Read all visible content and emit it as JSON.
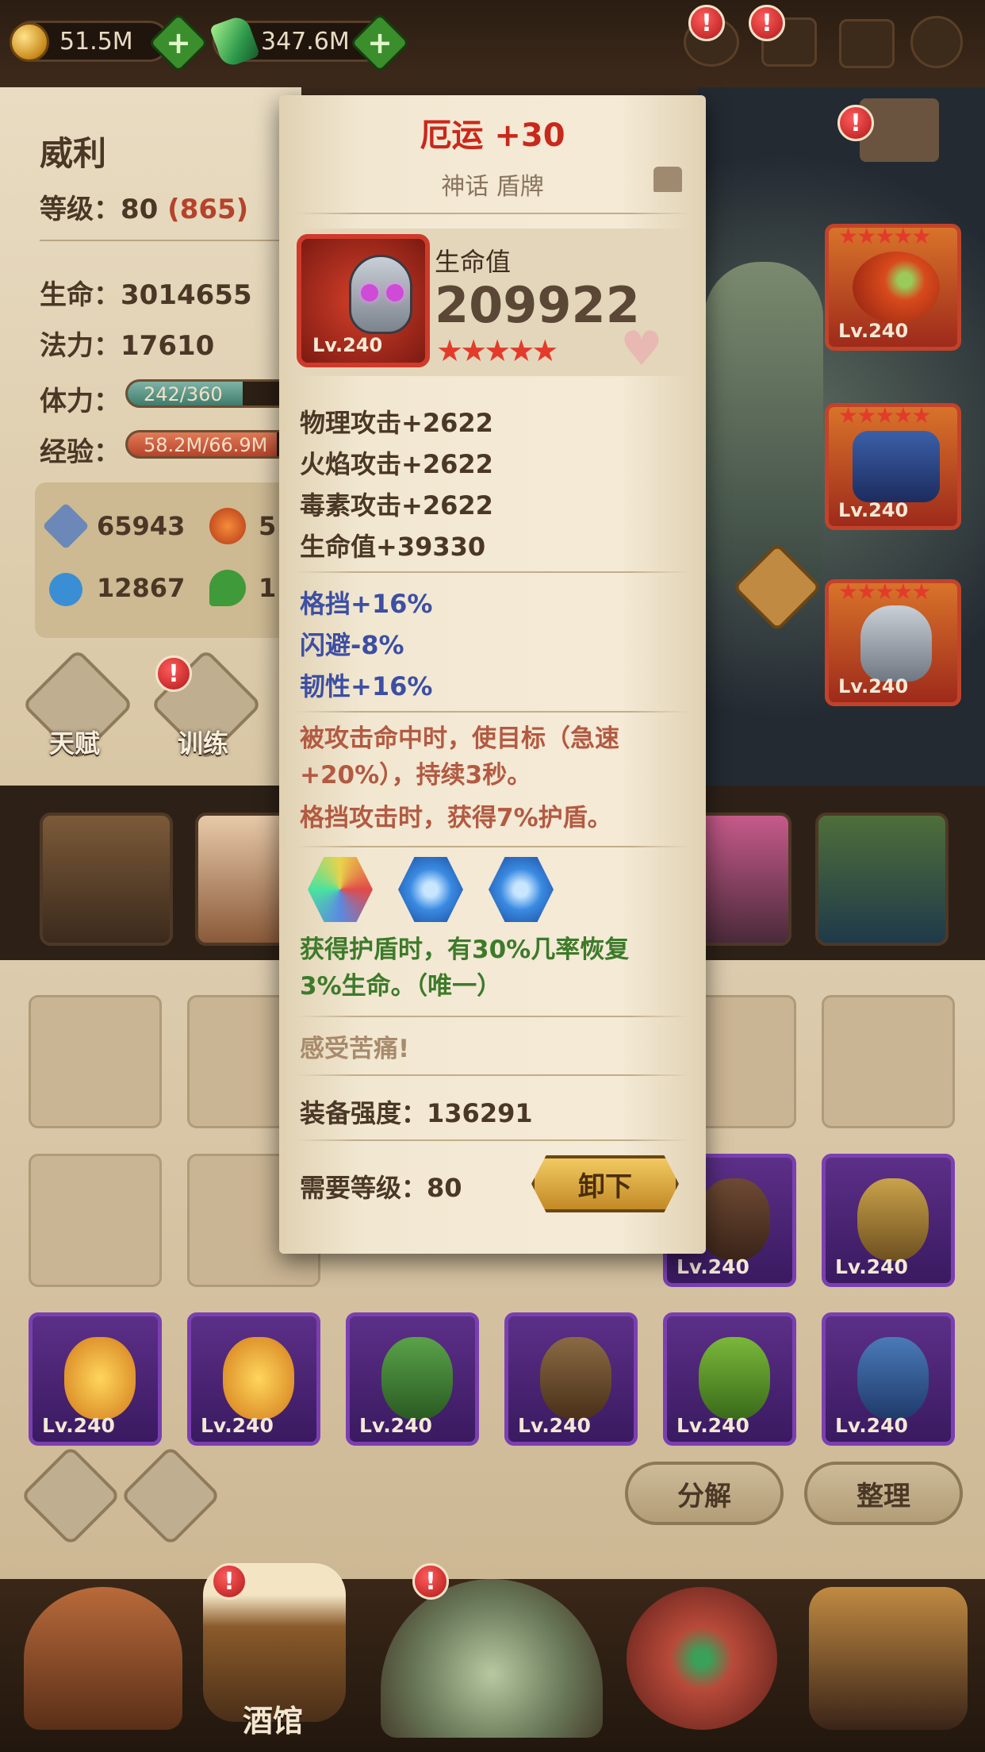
{
  "topbar": {
    "gold": "51.5M",
    "gems": "347.6M",
    "alert_mark": "!"
  },
  "hero": {
    "name": "威利",
    "level_label": "等级：",
    "level": "80",
    "level_extra": "(865)",
    "hp_label": "生命：",
    "hp": "3014655",
    "mp_label": "法力：",
    "mp": "17610",
    "stamina_label": "体力：",
    "stamina": "242/360",
    "stamina_fraction": 0.67,
    "exp_label": "经验：",
    "exp": "58.2M/66.9M",
    "exp_fraction": 0.87,
    "stats": [
      "65943",
      "5",
      "12867",
      "1"
    ],
    "tabs": [
      "天赋",
      "训练"
    ]
  },
  "equipment_slots": [
    {
      "label": "Lv.240",
      "stars": "★★★★★"
    },
    {
      "label": "Lv.240",
      "stars": "★★★★★"
    },
    {
      "label": "Lv.240",
      "stars": "★★★★★"
    }
  ],
  "tooltip": {
    "title": "厄运 +30",
    "subtitle": "神话 盾牌",
    "item_level": "Lv.240",
    "main_stat_label": "生命值",
    "main_stat_value": "209922",
    "stars": "★★★★★",
    "base_stats": [
      "物理攻击+2622",
      "火焰攻击+2622",
      "毒素攻击+2622",
      "生命值+39330"
    ],
    "bonus_stats": [
      "格挡+16%",
      "闪避-8%",
      "韧性+16%"
    ],
    "effect_lines": [
      "被攻击命中时，使目标（急速",
      "+20%），持续3秒。",
      "格挡攻击时，获得7%护盾。"
    ],
    "set_lines": [
      "获得护盾时，有30%几率恢复",
      "3%生命。（唯一）"
    ],
    "flavor": "感受苦痛!",
    "power_label": "装备强度：",
    "power": "136291",
    "req_label": "需要等级：",
    "req_level": "80",
    "unequip": "卸下"
  },
  "inventory": {
    "item_label": "Lv.240",
    "actions": [
      "分解",
      "整理"
    ]
  },
  "nav": {
    "tavern": "酒馆"
  },
  "colors": {
    "mythic_red": "#c9281c",
    "epic_purple": "#7a3fb0",
    "bonus_blue": "#3d4fa3",
    "set_green": "#3d7a2a"
  }
}
